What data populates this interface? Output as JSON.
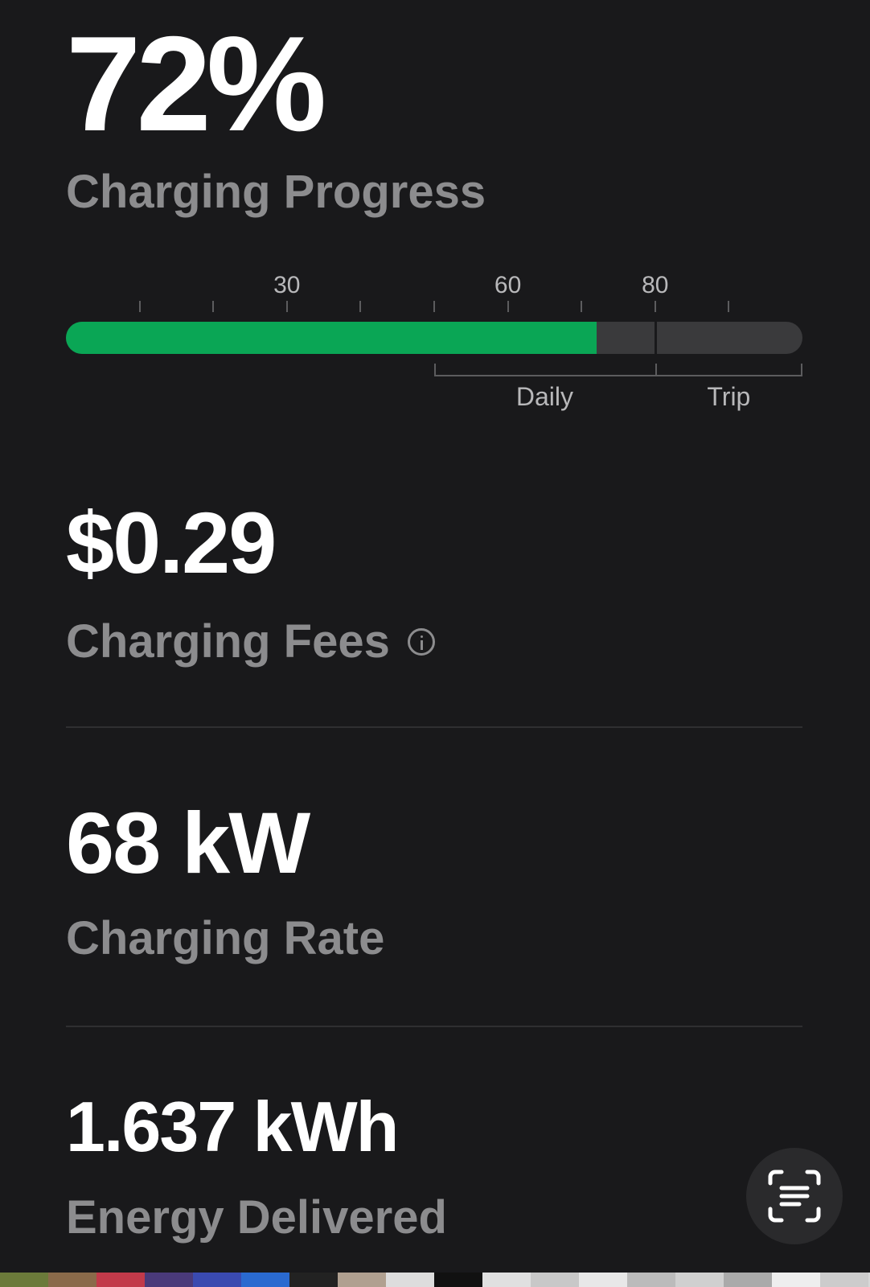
{
  "progress": {
    "value_text": "72%",
    "label": "Charging Progress",
    "percent": 72,
    "scale_labels": [
      {
        "text": "30",
        "at": 30
      },
      {
        "text": "60",
        "at": 60
      },
      {
        "text": "80",
        "at": 80
      }
    ],
    "ranges": [
      {
        "label": "Daily",
        "from": 50,
        "to": 80
      },
      {
        "label": "Trip",
        "from": 80,
        "to": 100
      }
    ],
    "fill_color": "#0aa655"
  },
  "fees": {
    "value_text": "$0.29",
    "label": "Charging Fees",
    "icon": "info-icon"
  },
  "rate": {
    "value_text": "68 kW",
    "label": "Charging Rate"
  },
  "energy": {
    "value_text": "1.637 kWh",
    "label": "Energy Delivered"
  },
  "scan_button": {
    "icon": "scan-text-icon"
  }
}
